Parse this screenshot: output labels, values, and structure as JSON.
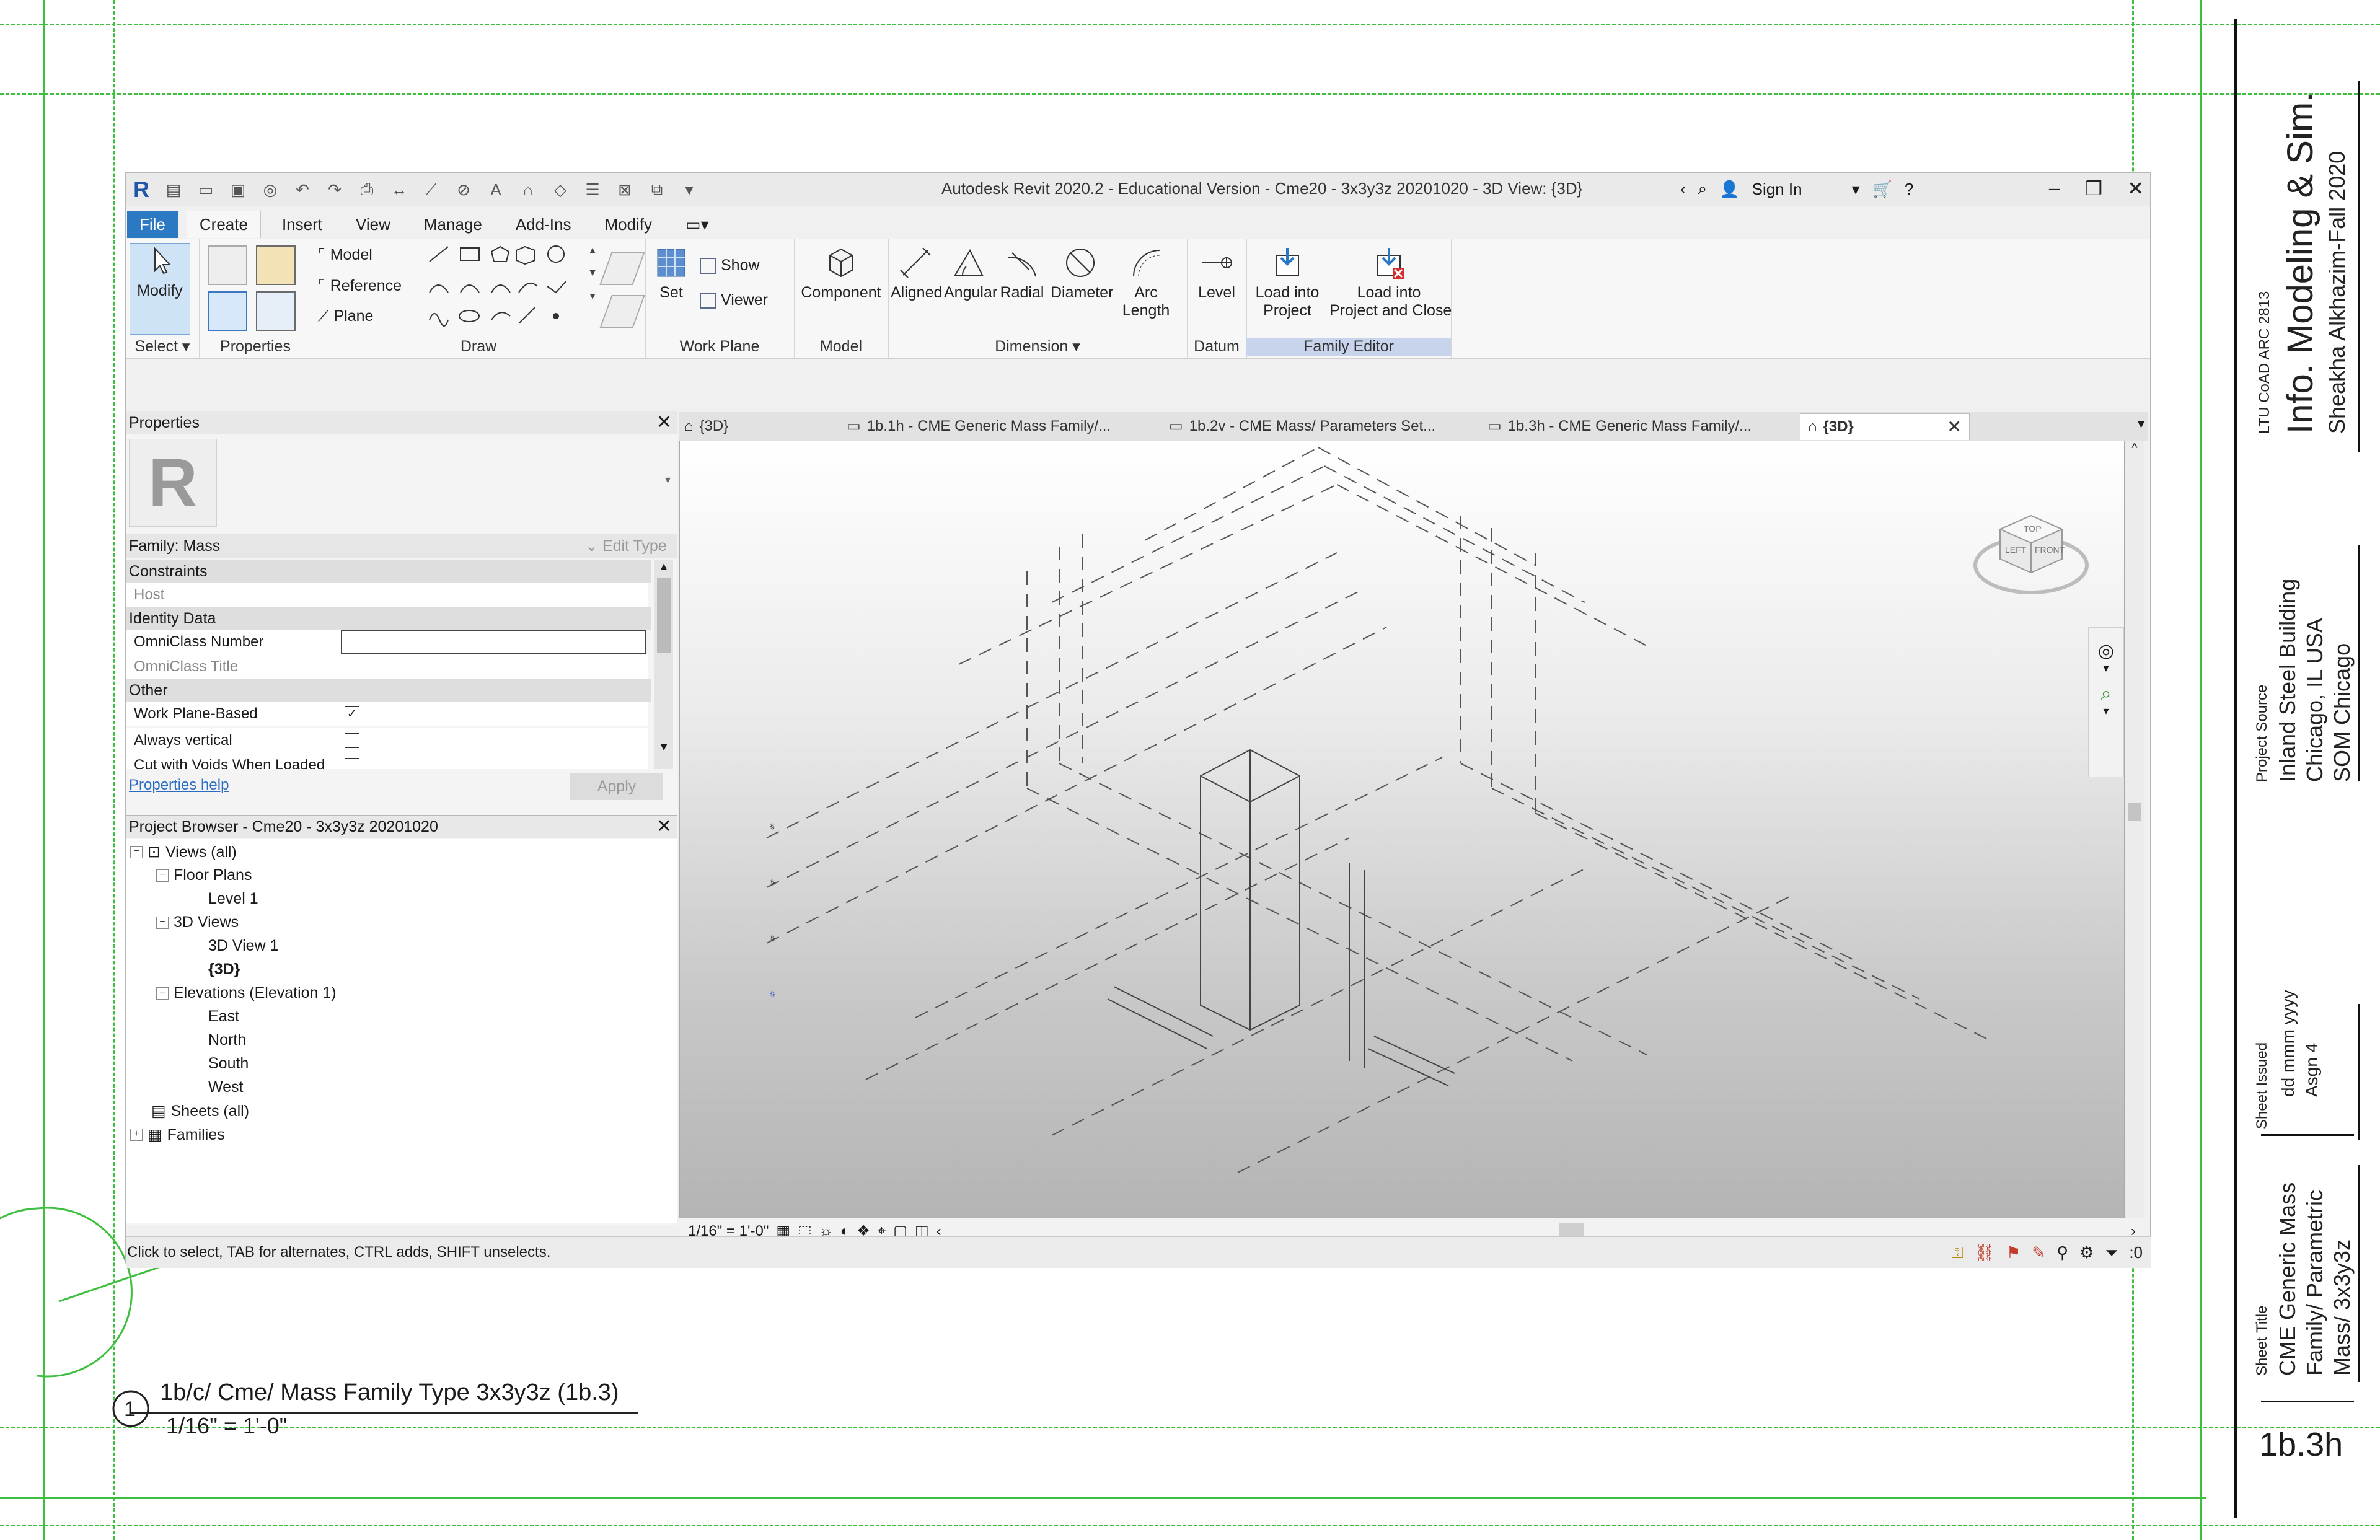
{
  "sheet": {
    "view_number": "1",
    "view_title": "1b/c/ Cme/ Mass Family Type 3x3y3z (1b.3)",
    "view_scale": "1/16\" = 1'-0\"",
    "course": "LTU CoAD ARC 2813",
    "course_title": "Info. Modeling & Sim.",
    "author_term": "Sheakha Alkhazim-Fall 2020",
    "project_source_label": "Project Source",
    "project_source": [
      "Inland Steel Building",
      "Chicago, IL USA",
      "SOM Chicago"
    ],
    "sheet_issued_label": "Sheet Issued",
    "sheet_issued": [
      "dd mmm yyyy",
      "Asgn 4"
    ],
    "sheet_title_label": "Sheet Title",
    "sheet_title": [
      "CME Generic Mass",
      "Family/ Parametric",
      "Mass/ 3x3y3z"
    ],
    "sheet_number": "1b.3h"
  },
  "revit": {
    "title": "Autodesk Revit 2020.2 - Educational Version - Cme20 - 3x3y3z 20201020 - 3D View: {3D}",
    "sign_in": "Sign In",
    "ribbon_tabs": [
      "File",
      "Create",
      "Insert",
      "View",
      "Manage",
      "Add-Ins",
      "Modify"
    ],
    "active_tab": "Create",
    "panels": {
      "select": "Select",
      "properties": "Properties",
      "draw": "Draw",
      "work_plane": "Work Plane",
      "model": "Model",
      "dimension": "Dimension",
      "datum": "Datum",
      "family_editor": "Family Editor"
    },
    "buttons": {
      "modify": "Modify",
      "model_line": "Model",
      "reference": "Reference",
      "plane": "Plane",
      "set": "Set",
      "show": "Show",
      "viewer": "Viewer",
      "component": "Component",
      "aligned": "Aligned",
      "angular": "Angular",
      "radial": "Radial",
      "diameter": "Diameter",
      "arc_length": [
        "Arc",
        "Length"
      ],
      "level": "Level",
      "load_into_project": [
        "Load into",
        "Project"
      ],
      "load_into_project_close": [
        "Load into",
        "Project and Close"
      ]
    },
    "properties_palette": {
      "title": "Properties",
      "family": "Family: Mass",
      "edit_type": "Edit Type",
      "groups": [
        {
          "name": "Constraints",
          "rows": [
            {
              "label": "Host",
              "value": ""
            }
          ]
        },
        {
          "name": "Identity Data",
          "rows": [
            {
              "label": "OmniClass Number",
              "value": ""
            },
            {
              "label": "OmniClass Title",
              "value": ""
            }
          ]
        },
        {
          "name": "Other",
          "rows": [
            {
              "label": "Work Plane-Based",
              "value": "checked"
            },
            {
              "label": "Always vertical",
              "value": "unchecked"
            },
            {
              "label": "Cut with Voids When Loaded",
              "value": "unchecked"
            }
          ]
        }
      ],
      "help_link": "Properties help",
      "apply": "Apply"
    },
    "project_browser": {
      "title": "Project Browser - Cme20 - 3x3y3z 20201020",
      "items": [
        {
          "label": "Views (all)",
          "level": 0
        },
        {
          "label": "Floor Plans",
          "level": 1
        },
        {
          "label": "Level 1",
          "level": 2
        },
        {
          "label": "3D Views",
          "level": 1
        },
        {
          "label": "3D View 1",
          "level": 2
        },
        {
          "label": "{3D}",
          "level": 2
        },
        {
          "label": "Elevations (Elevation 1)",
          "level": 1
        },
        {
          "label": "East",
          "level": 2
        },
        {
          "label": "North",
          "level": 2
        },
        {
          "label": "South",
          "level": 2
        },
        {
          "label": "West",
          "level": 2
        },
        {
          "label": "Sheets (all)",
          "level": 0
        },
        {
          "label": "Families",
          "level": 0
        }
      ]
    },
    "view_tabs": [
      "{3D}",
      "1b.1h - CME Generic Mass Family/...",
      "1b.2v - CME Mass/ Parameters Set...",
      "1b.3h - CME Generic Mass Family/...",
      "{3D}"
    ],
    "view_scale": "1/16\" = 1'-0\"",
    "viewcube": {
      "top": "TOP",
      "left": "LEFT",
      "front": "FRONT"
    },
    "status": "Click to select, TAB for alternates, CTRL adds, SHIFT unselects.",
    "filter_count": ":0"
  }
}
